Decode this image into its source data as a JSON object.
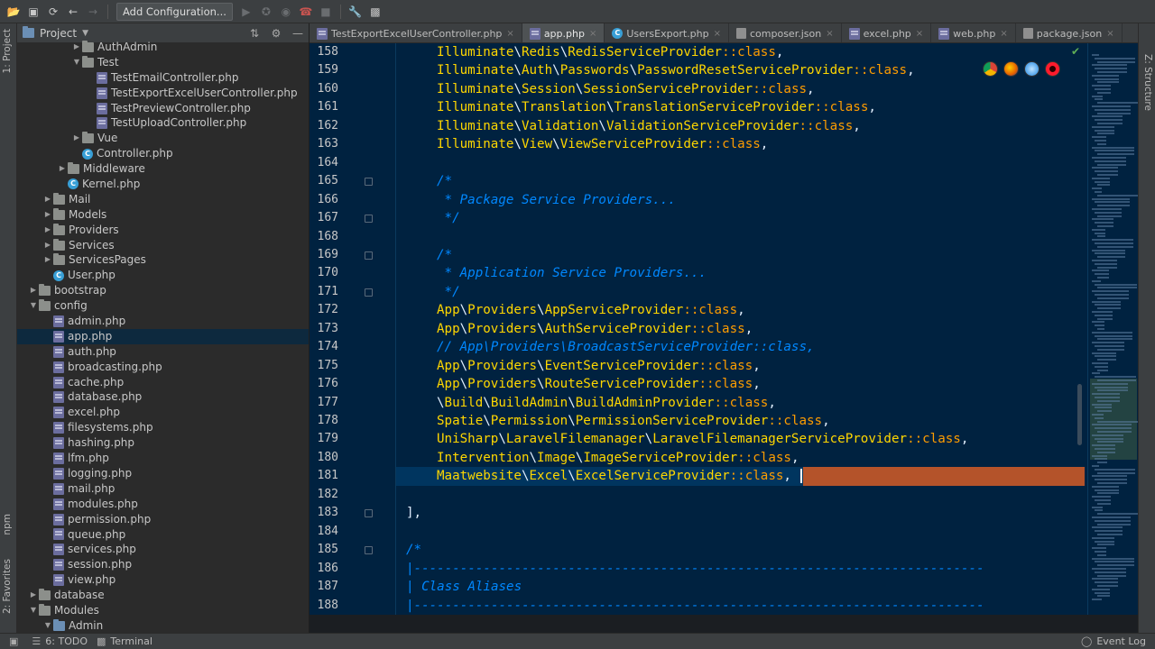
{
  "toolbar": {
    "add_configuration": "Add Configuration..."
  },
  "left_strip": {
    "project_tab": "1: Project",
    "npm_tab": "npm",
    "favorites_tab": "2: Favorites"
  },
  "right_strip": {
    "structure_tab": "Z: Structure"
  },
  "project_panel": {
    "title": "Project",
    "tree": [
      {
        "label": "AuthAdmin",
        "depth": 4,
        "kind": "folder",
        "arrow": "right"
      },
      {
        "label": "Test",
        "depth": 4,
        "kind": "folder",
        "arrow": "down"
      },
      {
        "label": "TestEmailController.php",
        "depth": 5,
        "kind": "php"
      },
      {
        "label": "TestExportExcelUserController.php",
        "depth": 5,
        "kind": "php"
      },
      {
        "label": "TestPreviewController.php",
        "depth": 5,
        "kind": "php"
      },
      {
        "label": "TestUploadController.php",
        "depth": 5,
        "kind": "php"
      },
      {
        "label": "Vue",
        "depth": 4,
        "kind": "folder",
        "arrow": "right"
      },
      {
        "label": "Controller.php",
        "depth": 4,
        "kind": "class"
      },
      {
        "label": "Middleware",
        "depth": 3,
        "kind": "folder",
        "arrow": "right"
      },
      {
        "label": "Kernel.php",
        "depth": 3,
        "kind": "class"
      },
      {
        "label": "Mail",
        "depth": 2,
        "kind": "folder",
        "arrow": "right"
      },
      {
        "label": "Models",
        "depth": 2,
        "kind": "folder",
        "arrow": "right"
      },
      {
        "label": "Providers",
        "depth": 2,
        "kind": "folder",
        "arrow": "right"
      },
      {
        "label": "Services",
        "depth": 2,
        "kind": "folder",
        "arrow": "right"
      },
      {
        "label": "ServicesPages",
        "depth": 2,
        "kind": "folder",
        "arrow": "right"
      },
      {
        "label": "User.php",
        "depth": 2,
        "kind": "class"
      },
      {
        "label": "bootstrap",
        "depth": 1,
        "kind": "folder",
        "arrow": "right"
      },
      {
        "label": "config",
        "depth": 1,
        "kind": "folder",
        "arrow": "down"
      },
      {
        "label": "admin.php",
        "depth": 2,
        "kind": "php"
      },
      {
        "label": "app.php",
        "depth": 2,
        "kind": "php",
        "selected": true
      },
      {
        "label": "auth.php",
        "depth": 2,
        "kind": "php"
      },
      {
        "label": "broadcasting.php",
        "depth": 2,
        "kind": "php"
      },
      {
        "label": "cache.php",
        "depth": 2,
        "kind": "php"
      },
      {
        "label": "database.php",
        "depth": 2,
        "kind": "php"
      },
      {
        "label": "excel.php",
        "depth": 2,
        "kind": "php"
      },
      {
        "label": "filesystems.php",
        "depth": 2,
        "kind": "php"
      },
      {
        "label": "hashing.php",
        "depth": 2,
        "kind": "php"
      },
      {
        "label": "lfm.php",
        "depth": 2,
        "kind": "php"
      },
      {
        "label": "logging.php",
        "depth": 2,
        "kind": "php"
      },
      {
        "label": "mail.php",
        "depth": 2,
        "kind": "php"
      },
      {
        "label": "modules.php",
        "depth": 2,
        "kind": "php"
      },
      {
        "label": "permission.php",
        "depth": 2,
        "kind": "php"
      },
      {
        "label": "queue.php",
        "depth": 2,
        "kind": "php"
      },
      {
        "label": "services.php",
        "depth": 2,
        "kind": "php"
      },
      {
        "label": "session.php",
        "depth": 2,
        "kind": "php"
      },
      {
        "label": "view.php",
        "depth": 2,
        "kind": "php"
      },
      {
        "label": "database",
        "depth": 1,
        "kind": "folder",
        "arrow": "right"
      },
      {
        "label": "Modules",
        "depth": 1,
        "kind": "folder",
        "arrow": "down"
      },
      {
        "label": "Admin",
        "depth": 2,
        "kind": "folder-blue",
        "arrow": "down"
      }
    ]
  },
  "tabs": [
    {
      "label": "TestExportExcelUserController.php",
      "icon": "php"
    },
    {
      "label": "app.php",
      "icon": "php",
      "active": true
    },
    {
      "label": "UsersExport.php",
      "icon": "class"
    },
    {
      "label": "composer.json",
      "icon": "json"
    },
    {
      "label": "excel.php",
      "icon": "php"
    },
    {
      "label": "web.php",
      "icon": "php"
    },
    {
      "label": "package.json",
      "icon": "json"
    }
  ],
  "editor": {
    "current_line": "181",
    "lines": [
      {
        "n": "158",
        "tokens": [
          [
            "id",
            "Illuminate"
          ],
          [
            "w",
            "\\"
          ],
          [
            "id",
            "Redis"
          ],
          [
            "w",
            "\\"
          ],
          [
            "id",
            "RedisServiceProvider"
          ],
          [
            "op",
            "::class"
          ],
          [
            "w",
            ","
          ]
        ],
        "indent": 4
      },
      {
        "n": "159",
        "tokens": [
          [
            "id",
            "Illuminate"
          ],
          [
            "w",
            "\\"
          ],
          [
            "id",
            "Auth"
          ],
          [
            "w",
            "\\"
          ],
          [
            "id",
            "Passwords"
          ],
          [
            "w",
            "\\"
          ],
          [
            "id",
            "PasswordResetServiceProvider"
          ],
          [
            "op",
            "::class"
          ],
          [
            "w",
            ","
          ]
        ],
        "indent": 4
      },
      {
        "n": "160",
        "tokens": [
          [
            "id",
            "Illuminate"
          ],
          [
            "w",
            "\\"
          ],
          [
            "id",
            "Session"
          ],
          [
            "w",
            "\\"
          ],
          [
            "id",
            "SessionServiceProvider"
          ],
          [
            "op",
            "::class"
          ],
          [
            "w",
            ","
          ]
        ],
        "indent": 4
      },
      {
        "n": "161",
        "tokens": [
          [
            "id",
            "Illuminate"
          ],
          [
            "w",
            "\\"
          ],
          [
            "id",
            "Translation"
          ],
          [
            "w",
            "\\"
          ],
          [
            "id",
            "TranslationServiceProvider"
          ],
          [
            "op",
            "::class"
          ],
          [
            "w",
            ","
          ]
        ],
        "indent": 4
      },
      {
        "n": "162",
        "tokens": [
          [
            "id",
            "Illuminate"
          ],
          [
            "w",
            "\\"
          ],
          [
            "id",
            "Validation"
          ],
          [
            "w",
            "\\"
          ],
          [
            "id",
            "ValidationServiceProvider"
          ],
          [
            "op",
            "::class"
          ],
          [
            "w",
            ","
          ]
        ],
        "indent": 4
      },
      {
        "n": "163",
        "tokens": [
          [
            "id",
            "Illuminate"
          ],
          [
            "w",
            "\\"
          ],
          [
            "id",
            "View"
          ],
          [
            "w",
            "\\"
          ],
          [
            "id",
            "ViewServiceProvider"
          ],
          [
            "op",
            "::class"
          ],
          [
            "w",
            ","
          ]
        ],
        "indent": 4
      },
      {
        "n": "164",
        "tokens": [],
        "indent": 4
      },
      {
        "n": "165",
        "tokens": [
          [
            "c",
            "/*"
          ]
        ],
        "indent": 4,
        "fold": true
      },
      {
        "n": "166",
        "tokens": [
          [
            "c",
            " * Package Service Providers..."
          ]
        ],
        "indent": 4
      },
      {
        "n": "167",
        "tokens": [
          [
            "c",
            " */"
          ]
        ],
        "indent": 4,
        "fold": true
      },
      {
        "n": "168",
        "tokens": [],
        "indent": 4
      },
      {
        "n": "169",
        "tokens": [
          [
            "c",
            "/*"
          ]
        ],
        "indent": 4,
        "fold": true
      },
      {
        "n": "170",
        "tokens": [
          [
            "c",
            " * Application Service Providers..."
          ]
        ],
        "indent": 4
      },
      {
        "n": "171",
        "tokens": [
          [
            "c",
            " */"
          ]
        ],
        "indent": 4,
        "fold": true
      },
      {
        "n": "172",
        "tokens": [
          [
            "id",
            "App"
          ],
          [
            "w",
            "\\"
          ],
          [
            "id",
            "Providers"
          ],
          [
            "w",
            "\\"
          ],
          [
            "id",
            "AppServiceProvider"
          ],
          [
            "op",
            "::class"
          ],
          [
            "w",
            ","
          ]
        ],
        "indent": 4
      },
      {
        "n": "173",
        "tokens": [
          [
            "id",
            "App"
          ],
          [
            "w",
            "\\"
          ],
          [
            "id",
            "Providers"
          ],
          [
            "w",
            "\\"
          ],
          [
            "id",
            "AuthServiceProvider"
          ],
          [
            "op",
            "::class"
          ],
          [
            "w",
            ","
          ]
        ],
        "indent": 4
      },
      {
        "n": "174",
        "tokens": [
          [
            "c",
            "// App\\Providers\\BroadcastServiceProvider::class,"
          ]
        ],
        "indent": 4
      },
      {
        "n": "175",
        "tokens": [
          [
            "id",
            "App"
          ],
          [
            "w",
            "\\"
          ],
          [
            "id",
            "Providers"
          ],
          [
            "w",
            "\\"
          ],
          [
            "id",
            "EventServiceProvider"
          ],
          [
            "op",
            "::class"
          ],
          [
            "w",
            ","
          ]
        ],
        "indent": 4
      },
      {
        "n": "176",
        "tokens": [
          [
            "id",
            "App"
          ],
          [
            "w",
            "\\"
          ],
          [
            "id",
            "Providers"
          ],
          [
            "w",
            "\\"
          ],
          [
            "id",
            "RouteServiceProvider"
          ],
          [
            "op",
            "::class"
          ],
          [
            "w",
            ","
          ]
        ],
        "indent": 4
      },
      {
        "n": "177",
        "tokens": [
          [
            "w",
            "\\"
          ],
          [
            "id",
            "Build"
          ],
          [
            "w",
            "\\"
          ],
          [
            "id",
            "BuildAdmin"
          ],
          [
            "w",
            "\\"
          ],
          [
            "id",
            "BuildAdminProvider"
          ],
          [
            "op",
            "::class"
          ],
          [
            "w",
            ","
          ]
        ],
        "indent": 4
      },
      {
        "n": "178",
        "tokens": [
          [
            "id",
            "Spatie"
          ],
          [
            "w",
            "\\"
          ],
          [
            "id",
            "Permission"
          ],
          [
            "w",
            "\\"
          ],
          [
            "id",
            "PermissionServiceProvider"
          ],
          [
            "op",
            "::class"
          ],
          [
            "w",
            ","
          ]
        ],
        "indent": 4
      },
      {
        "n": "179",
        "tokens": [
          [
            "id",
            "UniSharp"
          ],
          [
            "w",
            "\\"
          ],
          [
            "id",
            "LaravelFilemanager"
          ],
          [
            "w",
            "\\"
          ],
          [
            "id",
            "LaravelFilemanagerServiceProvider"
          ],
          [
            "op",
            "::class"
          ],
          [
            "w",
            ","
          ]
        ],
        "indent": 4
      },
      {
        "n": "180",
        "tokens": [
          [
            "id",
            "Intervention"
          ],
          [
            "w",
            "\\"
          ],
          [
            "id",
            "Image"
          ],
          [
            "w",
            "\\"
          ],
          [
            "id",
            "ImageServiceProvider"
          ],
          [
            "op",
            "::class"
          ],
          [
            "w",
            ","
          ]
        ],
        "indent": 4
      },
      {
        "n": "181",
        "tokens": [
          [
            "id",
            "Maatwebsite"
          ],
          [
            "w",
            "\\"
          ],
          [
            "id",
            "Excel"
          ],
          [
            "w",
            "\\"
          ],
          [
            "id",
            "ExcelServiceProvider"
          ],
          [
            "op",
            "::class"
          ],
          [
            "w",
            ","
          ]
        ],
        "indent": 4,
        "current": true
      },
      {
        "n": "182",
        "tokens": [],
        "indent": 4
      },
      {
        "n": "183",
        "tokens": [
          [
            "w",
            "],"
          ]
        ],
        "indent": 0,
        "fold": true
      },
      {
        "n": "184",
        "tokens": [],
        "indent": 0
      },
      {
        "n": "185",
        "tokens": [
          [
            "c",
            "/*"
          ]
        ],
        "indent": 0,
        "fold": true
      },
      {
        "n": "186",
        "tokens": [
          [
            "c",
            "|--------------------------------------------------------------------------"
          ]
        ],
        "indent": 0
      },
      {
        "n": "187",
        "tokens": [
          [
            "c",
            "| Class Aliases"
          ]
        ],
        "indent": 0
      },
      {
        "n": "188",
        "tokens": [
          [
            "c",
            "|--------------------------------------------------------------------------"
          ]
        ],
        "indent": 0
      }
    ]
  },
  "statusbar": {
    "todo": "6: TODO",
    "terminal": "Terminal",
    "event_log": "Event Log"
  },
  "colors": {
    "editor_bg": "#002240",
    "identifier": "#ffd700",
    "keyword": "#ff9d00",
    "comment": "#0088ff",
    "selection": "#b4532a"
  }
}
